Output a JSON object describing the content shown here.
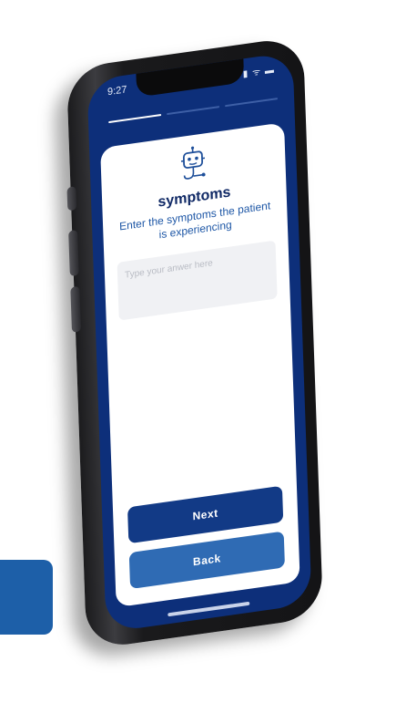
{
  "status_bar": {
    "time": "9:27",
    "icons": "▮ ᯤ ▬",
    "icon_names": [
      "signal-icon",
      "wifi-icon",
      "battery-icon"
    ]
  },
  "progress": {
    "current_step": 1,
    "total_steps": 3
  },
  "form": {
    "icon": "robot-stethoscope-icon",
    "title": "symptoms",
    "subtitle": "Enter the symptoms the patient is experiencing",
    "answer_value": "",
    "answer_placeholder": "Type your anwer here"
  },
  "buttons": {
    "next_label": "Next",
    "back_label": "Back"
  },
  "colors": {
    "screen_background": "#0d2f7a",
    "title": "#112a66",
    "subtitle": "#1e57a6",
    "next_button": "#123a86",
    "back_button": "#2f6bb4"
  }
}
